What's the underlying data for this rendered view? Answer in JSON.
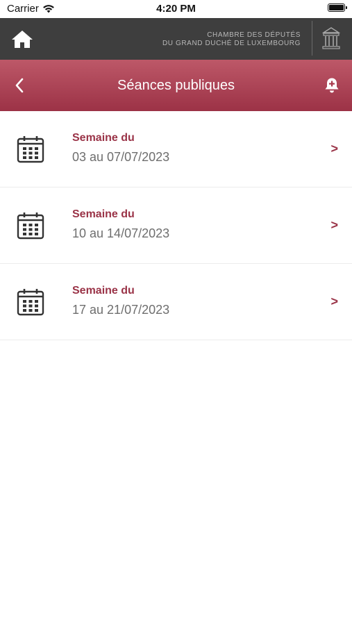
{
  "status": {
    "carrier": "Carrier",
    "time": "4:20 PM"
  },
  "header": {
    "brand_line1": "CHAMBRE DES DÉPUTÉS",
    "brand_line2": "DU GRAND DUCHÉ DE LUXEMBOURG"
  },
  "nav": {
    "title": "Séances publiques"
  },
  "weeks": [
    {
      "label": "Semaine du",
      "range": "03 au 07/07/2023",
      "chevron": ">"
    },
    {
      "label": "Semaine du",
      "range": "10 au 14/07/2023",
      "chevron": ">"
    },
    {
      "label": "Semaine du",
      "range": "17 au 21/07/2023",
      "chevron": ">"
    }
  ],
  "icons": {
    "home": "home-icon",
    "back": "chevron-left-icon",
    "alert": "bell-plus-icon",
    "calendar": "calendar-icon",
    "logo": "chamber-building-icon"
  },
  "colors": {
    "accent": "#9a3347",
    "nav_gradient_top": "#bd5868",
    "nav_gradient_bottom": "#9c3246",
    "header_bg": "#3e3e3e"
  }
}
